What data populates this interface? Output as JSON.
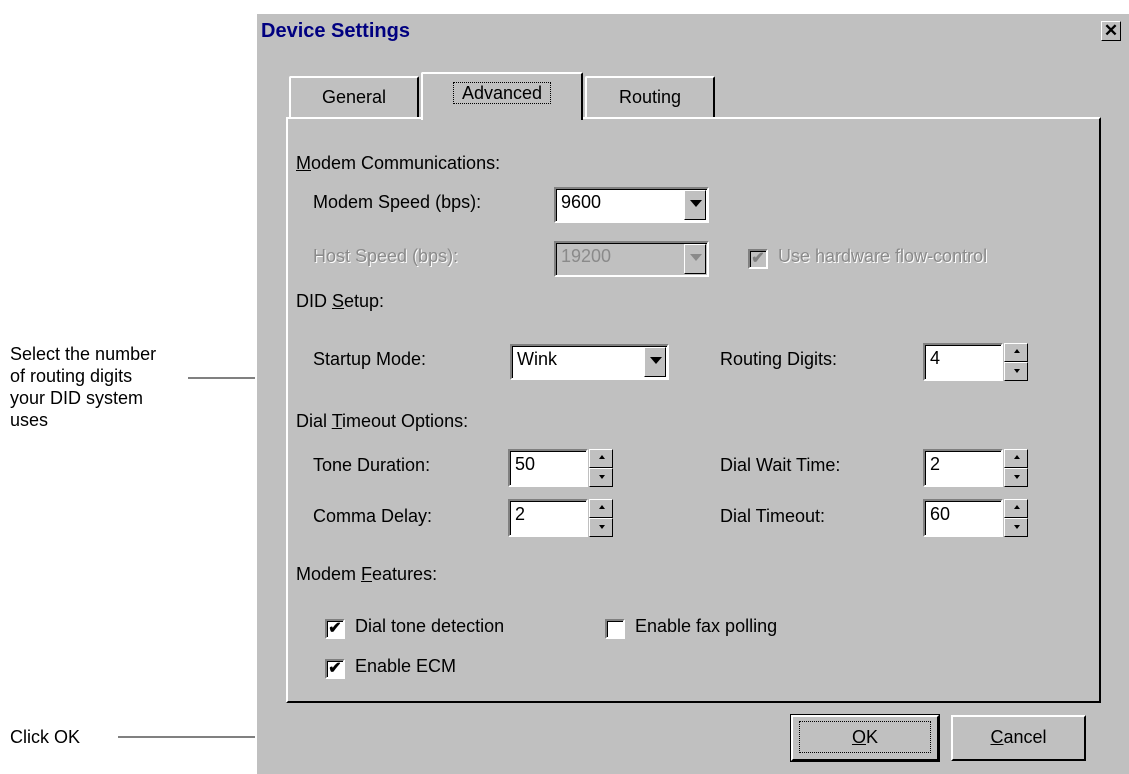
{
  "callouts": {
    "routing_digits": [
      "Select the number",
      "of routing digits",
      "your DID system",
      "uses"
    ],
    "ok": "Click OK"
  },
  "dialog": {
    "title": "Device Settings",
    "close_glyph": "✕",
    "tabs": [
      "General",
      "Advanced",
      "Routing"
    ],
    "active_tab": "Advanced"
  },
  "modem_comm": {
    "heading_accel": "M",
    "heading_rest": "odem Communications:",
    "modem_speed_label": "Modem Speed (bps):",
    "modem_speed_value": "9600",
    "host_speed_label": "Host Speed (bps):",
    "host_speed_value": "19200",
    "flow_control_label": "Use hardware flow-control",
    "flow_control_checked": true
  },
  "did_setup": {
    "heading_pre": "DID ",
    "heading_accel": "S",
    "heading_rest": "etup:",
    "startup_mode_label": "Startup Mode:",
    "startup_mode_value": "Wink",
    "routing_digits_label": "Routing Digits:",
    "routing_digits_value": "4"
  },
  "dial_timeout": {
    "heading_pre": "Dial ",
    "heading_accel": "T",
    "heading_rest": "imeout Options:",
    "tone_duration_label": "Tone Duration:",
    "tone_duration_value": "50",
    "comma_delay_label": "Comma Delay:",
    "comma_delay_value": "2",
    "dial_wait_label": "Dial Wait Time:",
    "dial_wait_value": "2",
    "dial_timeout_label": "Dial Timeout:",
    "dial_timeout_value": "60"
  },
  "modem_features": {
    "heading_pre": "Modem ",
    "heading_accel": "F",
    "heading_rest": "eatures:",
    "dial_tone_label": "Dial tone detection",
    "dial_tone_checked": true,
    "fax_polling_label": "Enable fax polling",
    "fax_polling_checked": false,
    "ecm_label": "Enable ECM",
    "ecm_checked": true
  },
  "buttons": {
    "ok_accel": "O",
    "ok_rest": "K",
    "cancel_accel": "C",
    "cancel_rest": "ancel"
  },
  "check_glyph": "✔"
}
